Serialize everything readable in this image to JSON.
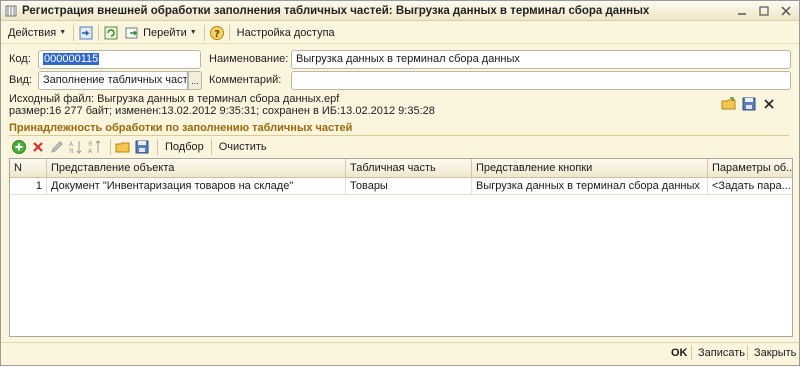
{
  "window": {
    "title": "Регистрация внешней обработки заполнения табличных частей: Выгрузка данных в терминал сбора данных"
  },
  "toolbar": {
    "actions_label": "Действия",
    "goto_label": "Перейти",
    "access_label": "Настройка доступа"
  },
  "form": {
    "code_label": "Код:",
    "code_value": "000000115",
    "name_label": "Наименование:",
    "name_value": "Выгрузка данных в терминал сбора данных",
    "kind_label": "Вид:",
    "kind_value": "Заполнение табличных частей",
    "pick_label": "...",
    "comment_label": "Комментарий:",
    "comment_value": ""
  },
  "file_info": {
    "source_line": "Исходный файл: Выгрузка данных в терминал сбора данных.epf",
    "size_line": "размер:16 277 байт; изменен:13.02.2012 9:35:31; сохранен в ИБ:13.02.2012 9:35:28"
  },
  "section": {
    "title": "Принадлежность обработки по заполнению табличных частей"
  },
  "table_toolbar": {
    "pick_label": "Подбор",
    "clear_label": "Очистить"
  },
  "table": {
    "columns": [
      "N",
      "Представление объекта",
      "Табличная часть",
      "Представление кнопки",
      "Параметры об..."
    ],
    "rows": [
      {
        "n": "1",
        "object": "Документ \"Инвентаризация товаров на складе\"",
        "part": "Товары",
        "button": "Выгрузка данных в терминал сбора данных",
        "params": "<Задать пара..."
      }
    ]
  },
  "footer": {
    "ok_label": "OK",
    "save_label": "Записать",
    "close_label": "Закрыть"
  },
  "colors": {
    "background": "#fbf5de",
    "section_title": "#9a6a0a",
    "selection": "#3167c7"
  }
}
